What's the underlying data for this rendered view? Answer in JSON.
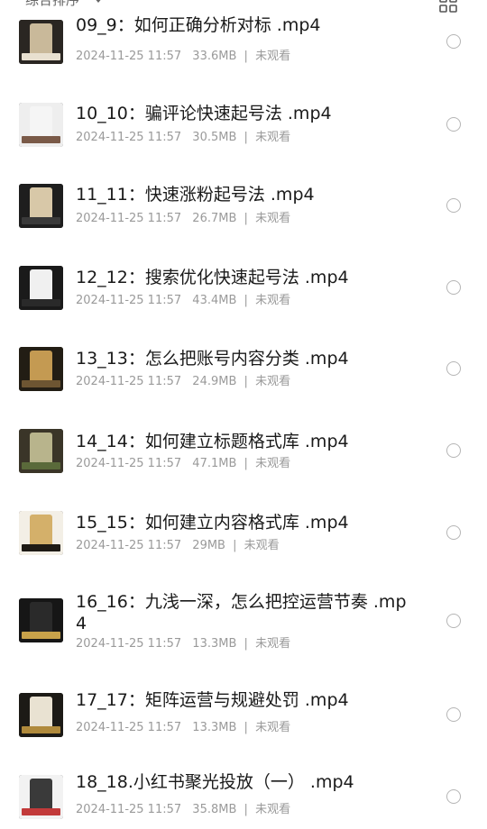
{
  "header": {
    "sort_label": "综合排序",
    "sort_caret_icon": "caret-down-icon",
    "view_toggle_icon": "grid-view-icon"
  },
  "files": [
    {
      "title": "09_9：如何正确分析对标 .mp4",
      "date": "2024-11-25 11:57",
      "size": "33.6MB",
      "status": "未观看",
      "thumb": {
        "bg": "#2a2622",
        "phone": "#c9b99a",
        "bar": "#e8e0d0"
      }
    },
    {
      "title": "10_10：骗评论快速起号法 .mp4",
      "date": "2024-11-25 11:57",
      "size": "30.5MB",
      "status": "未观看",
      "thumb": {
        "bg": "#eeeeee",
        "phone": "#f5f5f5",
        "bar": "#7a5a48"
      }
    },
    {
      "title": "11_11：快速涨粉起号法 .mp4",
      "date": "2024-11-25 11:57",
      "size": "26.7MB",
      "status": "未观看",
      "thumb": {
        "bg": "#1e1e1e",
        "phone": "#d8c8a8",
        "bar": "#3a3a3a"
      }
    },
    {
      "title": "12_12：搜索优化快速起号法 .mp4",
      "date": "2024-11-25 11:57",
      "size": "43.4MB",
      "status": "未观看",
      "thumb": {
        "bg": "#1a1a1a",
        "phone": "#f0f0f0",
        "bar": "#2a2a2a"
      }
    },
    {
      "title": "13_13：怎么把账号内容分类 .mp4",
      "date": "2024-11-25 11:57",
      "size": "24.9MB",
      "status": "未观看",
      "thumb": {
        "bg": "#221d14",
        "phone": "#c49a52",
        "bar": "#6d5532"
      }
    },
    {
      "title": "14_14：如何建立标题格式库 .mp4",
      "date": "2024-11-25 11:57",
      "size": "47.1MB",
      "status": "未观看",
      "thumb": {
        "bg": "#3a3528",
        "phone": "#b8b48c",
        "bar": "#5a6a3a"
      }
    },
    {
      "title": "15_15：如何建立内容格式库 .mp4",
      "date": "2024-11-25 11:57",
      "size": "29MB",
      "status": "未观看",
      "thumb": {
        "bg": "#f3efe6",
        "phone": "#d4b06a",
        "bar": "#1e1a14"
      }
    },
    {
      "title": "16_16：九浅一深，怎么把控运营节奏 .mp4",
      "date": "2024-11-25 11:57",
      "size": "13.3MB",
      "status": "未观看",
      "thumb": {
        "bg": "#161616",
        "phone": "#2a2a2a",
        "bar": "#c8a24a"
      }
    },
    {
      "title": "17_17：矩阵运营与规避处罚 .mp4",
      "date": "2024-11-25 11:57",
      "size": "13.3MB",
      "status": "未观看",
      "thumb": {
        "bg": "#1c1a16",
        "phone": "#e9e2d2",
        "bar": "#b08a3c"
      }
    },
    {
      "title": "18_18.小红书聚光投放（一） .mp4",
      "date": "2024-11-25 11:57",
      "size": "35.8MB",
      "status": "未观看",
      "thumb": {
        "bg": "#f2f2f2",
        "phone": "#3a3a3a",
        "bar": "#c23a3a"
      }
    }
  ],
  "separator": "|",
  "radio_icon": "radio-unchecked-icon"
}
